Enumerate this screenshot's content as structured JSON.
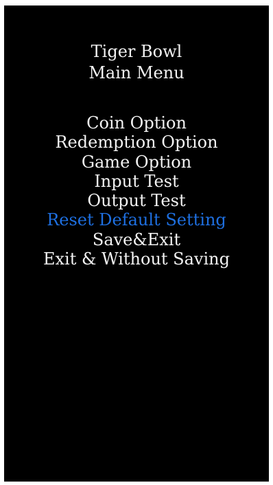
{
  "header": {
    "title": "Tiger Bowl",
    "subtitle": "Main Menu"
  },
  "menu": {
    "items": [
      {
        "label": "Coin Option",
        "selected": false
      },
      {
        "label": "Redemption Option",
        "selected": false
      },
      {
        "label": "Game Option",
        "selected": false
      },
      {
        "label": "Input Test",
        "selected": false
      },
      {
        "label": "Output Test",
        "selected": false
      },
      {
        "label": "Reset Default Setting",
        "selected": true
      },
      {
        "label": "Save&Exit",
        "selected": false
      },
      {
        "label": "Exit & Without Saving",
        "selected": false
      }
    ]
  },
  "colors": {
    "background": "#000000",
    "text": "#f2f2f2",
    "highlight": "#1e6fe0"
  }
}
